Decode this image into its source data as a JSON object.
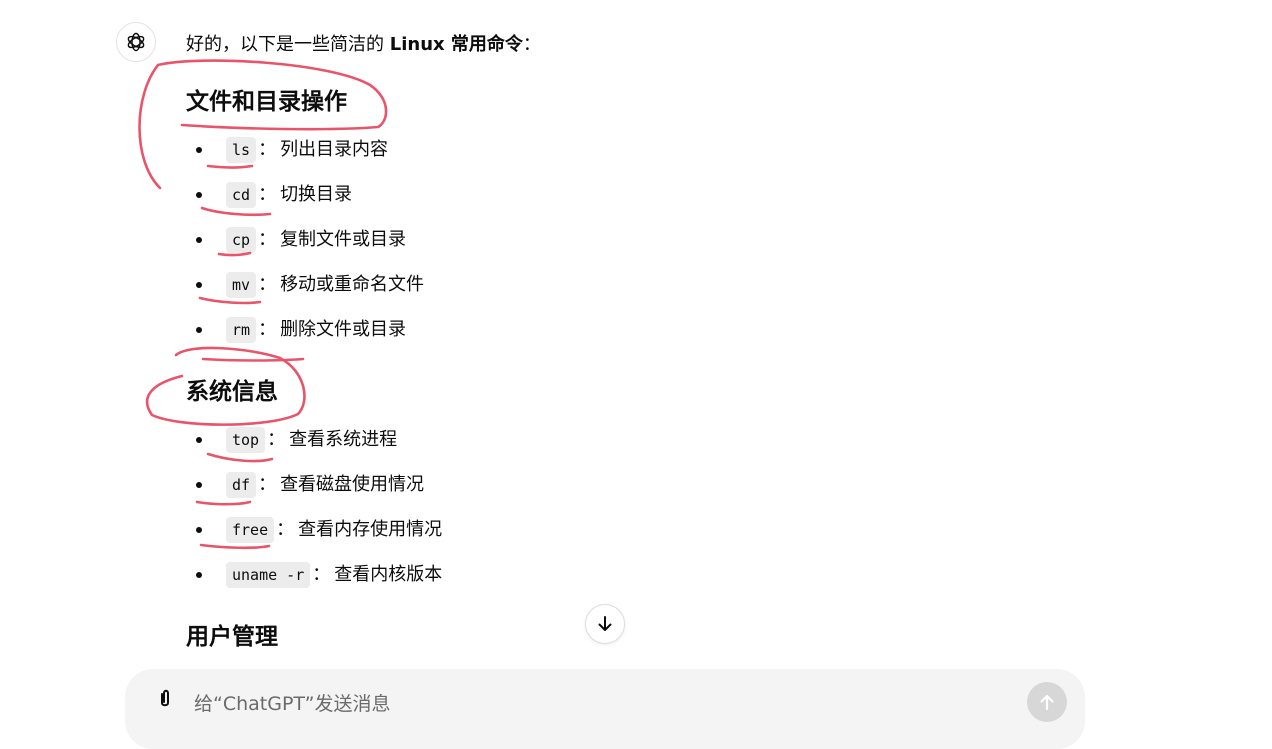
{
  "message": {
    "intro_prefix": "好的，以下是一些简洁的 ",
    "intro_bold": "Linux 常用命令",
    "intro_suffix": "："
  },
  "sections": [
    {
      "title": "文件和目录操作",
      "items": [
        {
          "cmd": "ls",
          "desc": "列出目录内容"
        },
        {
          "cmd": "cd",
          "desc": "切换目录"
        },
        {
          "cmd": "cp",
          "desc": "复制文件或目录"
        },
        {
          "cmd": "mv",
          "desc": "移动或重命名文件"
        },
        {
          "cmd": "rm",
          "desc": "删除文件或目录"
        }
      ]
    },
    {
      "title": "系统信息",
      "items": [
        {
          "cmd": "top",
          "desc": "查看系统进程"
        },
        {
          "cmd": "df",
          "desc": "查看磁盘使用情况"
        },
        {
          "cmd": "free",
          "desc": "查看内存使用情况"
        },
        {
          "cmd": "uname -r",
          "desc": "查看内核版本"
        }
      ]
    },
    {
      "title": "用户管理",
      "items": []
    }
  ],
  "colon": "：",
  "composer": {
    "placeholder": "给“ChatGPT”发送消息"
  },
  "icons": {
    "avatar": "openai-logo-icon",
    "scroll": "arrow-down-icon",
    "attach": "paperclip-icon",
    "send": "arrow-up-icon"
  },
  "colors": {
    "annotation": "#e8556a",
    "code_bg": "#ececec",
    "composer_bg": "#f4f4f4"
  }
}
